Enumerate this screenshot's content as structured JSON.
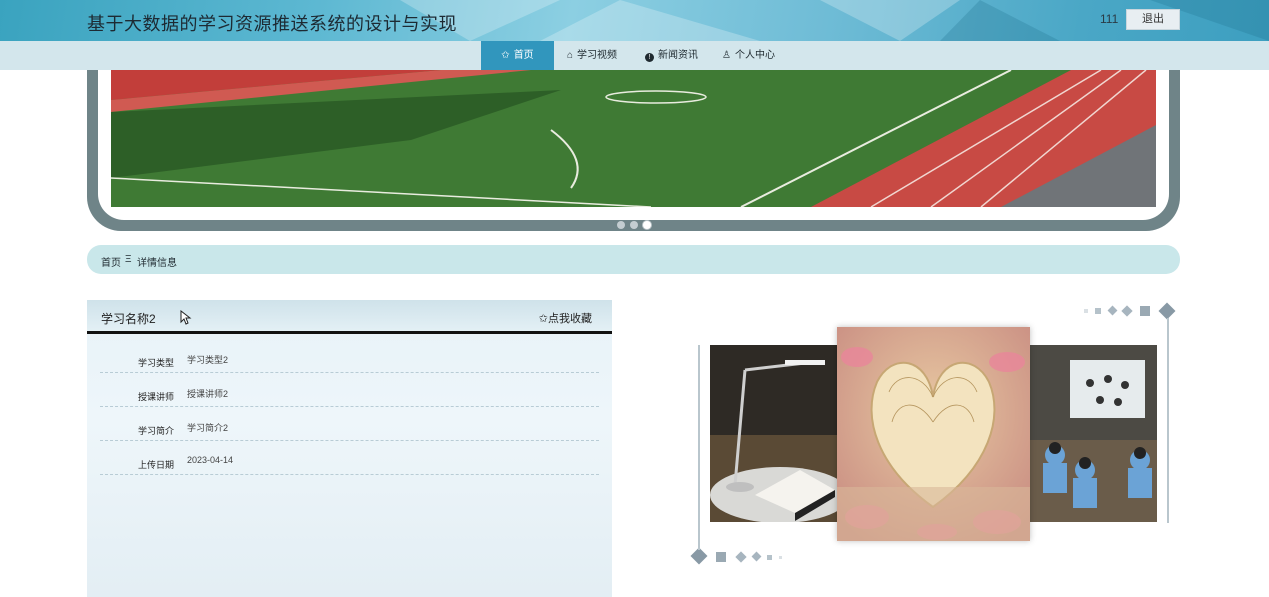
{
  "header": {
    "site_title": "基于大数据的学习资源推送系统的设计与实现",
    "username": "111",
    "logout_label": "退出"
  },
  "nav": {
    "items": [
      {
        "label": "首页",
        "icon": "star-icon",
        "active": true
      },
      {
        "label": "学习视频",
        "icon": "bag-icon",
        "active": false
      },
      {
        "label": "新闻资讯",
        "icon": "info-icon",
        "active": false
      },
      {
        "label": "个人中心",
        "icon": "user-icon",
        "active": false
      }
    ]
  },
  "banner": {
    "slide_count": 3,
    "active_slide": 3
  },
  "breadcrumb": {
    "home": "首页",
    "separator": "Ξ",
    "current": "详情信息"
  },
  "detail": {
    "title": "学习名称2",
    "favorite_label": "✩点我收藏",
    "fields": [
      {
        "label": "学习类型",
        "value": "学习类型2"
      },
      {
        "label": "授课讲师",
        "value": "授课讲师2"
      },
      {
        "label": "学习简介",
        "value": "学习简介2"
      },
      {
        "label": "上传日期",
        "value": "2023-04-14"
      }
    ]
  },
  "colors": {
    "header_accent": "#3aa3bf",
    "nav_active": "#3196bd",
    "breadcrumb_bg": "#c9e7ea",
    "banner_frame": "#6f8488"
  }
}
